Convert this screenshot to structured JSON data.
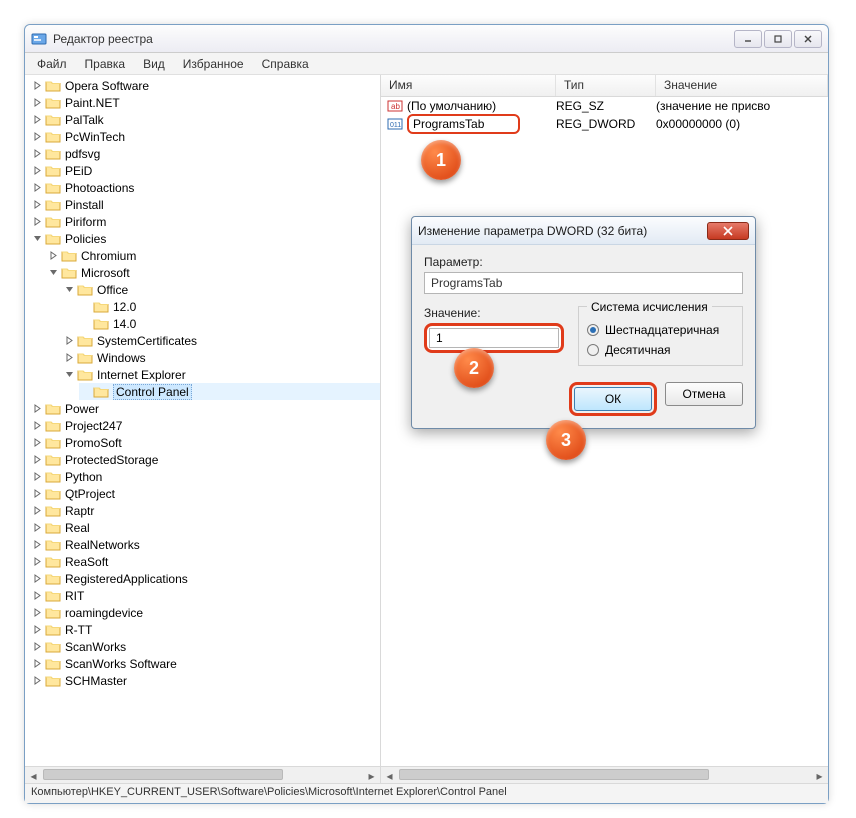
{
  "window": {
    "title": "Редактор реестра"
  },
  "menu": {
    "file": "Файл",
    "edit": "Правка",
    "view": "Вид",
    "favorites": "Избранное",
    "help": "Справка"
  },
  "columns": {
    "name": "Имя",
    "type": "Тип",
    "value": "Значение"
  },
  "list": {
    "default_name": "(По умолчанию)",
    "default_type": "REG_SZ",
    "default_value": "(значение не присво",
    "programs_name": "ProgramsTab",
    "programs_type": "REG_DWORD",
    "programs_value": "0x00000000 (0)"
  },
  "tree": {
    "items": [
      "Opera Software",
      "Paint.NET",
      "PalTalk",
      "PcWinTech",
      "pdfsvg",
      "PEiD",
      "Photoactions",
      "Pinstall",
      "Piriform"
    ],
    "policies": "Policies",
    "chromium": "Chromium",
    "microsoft": "Microsoft",
    "office": "Office",
    "v120": "12.0",
    "v140": "14.0",
    "syscert": "SystemCertificates",
    "windows": "Windows",
    "ie": "Internet Explorer",
    "cpl": "Control Panel",
    "power": "Power",
    "rest": [
      "Project247",
      "PromoSoft",
      "ProtectedStorage",
      "Python",
      "QtProject",
      "Raptr",
      "Real",
      "RealNetworks",
      "ReaSoft",
      "RegisteredApplications",
      "RIT",
      "roamingdevice",
      "R-TT",
      "ScanWorks",
      "ScanWorks Software",
      "SCHMaster"
    ]
  },
  "status": {
    "path": "Компьютер\\HKEY_CURRENT_USER\\Software\\Policies\\Microsoft\\Internet Explorer\\Control Panel"
  },
  "dialog": {
    "title": "Изменение параметра DWORD (32 бита)",
    "param_label": "Параметр:",
    "param_value": "ProgramsTab",
    "value_label": "Значение:",
    "value_value": "1",
    "radix_label": "Система исчисления",
    "hex": "Шестнадцатеричная",
    "dec": "Десятичная",
    "ok": "ОК",
    "cancel": "Отмена"
  },
  "callouts": {
    "c1": "1",
    "c2": "2",
    "c3": "3"
  }
}
